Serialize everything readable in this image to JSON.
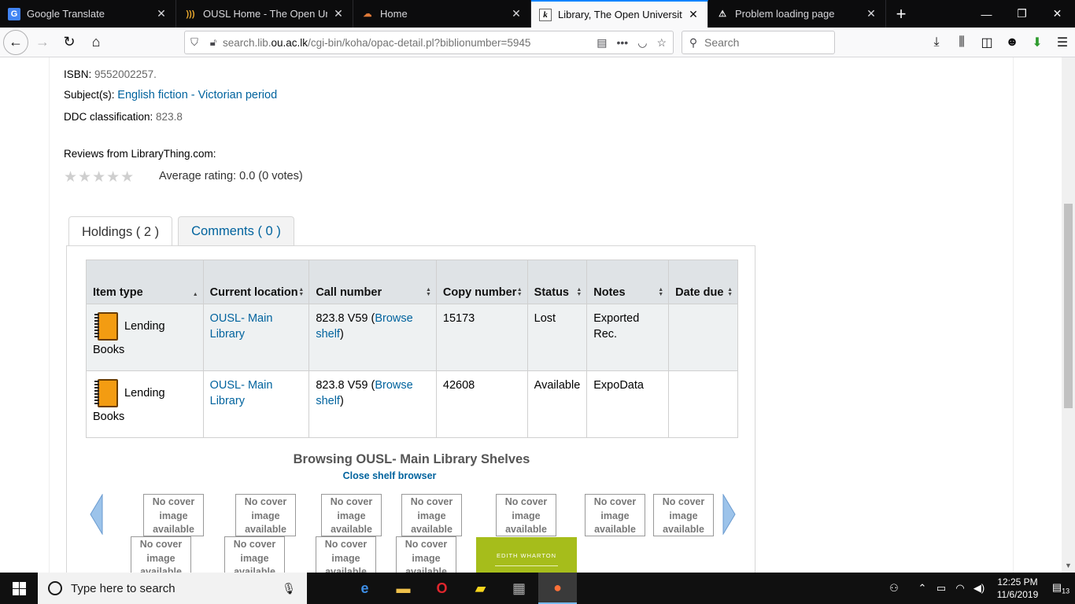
{
  "browser": {
    "tabs": [
      {
        "label": "Google Translate",
        "favicon": "google-translate-icon",
        "active": false
      },
      {
        "label": "OUSL Home - The Open Univer",
        "favicon": "ousl-icon",
        "active": false
      },
      {
        "label": "Home",
        "favicon": "home-favicon",
        "active": false
      },
      {
        "label": "Library, The Open University of",
        "favicon": "koha-icon",
        "active": true
      },
      {
        "label": "Problem loading page",
        "favicon": "warning-icon",
        "active": false
      }
    ],
    "url_prefix": "search.lib.",
    "url_domain": "ou.ac.lk",
    "url_rest": "/cgi-bin/koha/opac-detail.pl?biblionumber=5945",
    "search_placeholder": "Search"
  },
  "record": {
    "isbn_label": "ISBN:",
    "isbn_value": "9552002257.",
    "subjects_label": "Subject(s):",
    "subjects_link": "English fiction - Victorian period",
    "ddc_label": "DDC classification:",
    "ddc_value": "823.8",
    "reviews_label": "Reviews from LibraryThing.com:",
    "stars": "★★★★★",
    "rating_text": "Average rating: 0.0 (0 votes)"
  },
  "tabs": {
    "holdings": "Holdings ( 2 )",
    "comments": "Comments ( 0 )"
  },
  "holdings": {
    "headers": [
      "Item type",
      "Current location",
      "Call number",
      "Copy number",
      "Status",
      "Notes",
      "Date due"
    ],
    "rows": [
      {
        "type_a": "Lending",
        "type_b": "Books",
        "location": "OUSL- Main Library",
        "call": "823.8 V59 (",
        "browse": "Browse shelf",
        "call_end": ")",
        "copy": "15173",
        "status": "Lost",
        "notes": "Exported Rec.",
        "due": ""
      },
      {
        "type_a": "Lending",
        "type_b": "Books",
        "location": "OUSL- Main Library",
        "call": "823.8 V59 (",
        "browse": "Browse shelf",
        "call_end": ")",
        "copy": "42608",
        "status": "Available",
        "notes": "ExpoData",
        "due": ""
      }
    ]
  },
  "shelf": {
    "title": "Browsing OUSL- Main Library Shelves",
    "close": "Close shelf browser",
    "no_cover": "No cover image available",
    "wharton_author": "EDITH WHARTON"
  },
  "taskbar": {
    "search_placeholder": "Type here to search",
    "time": "12:25 PM",
    "date": "11/6/2019",
    "notifications": "13"
  },
  "colors": {
    "link": "#00639e",
    "available": "#006100",
    "accent": "#0a84ff"
  }
}
